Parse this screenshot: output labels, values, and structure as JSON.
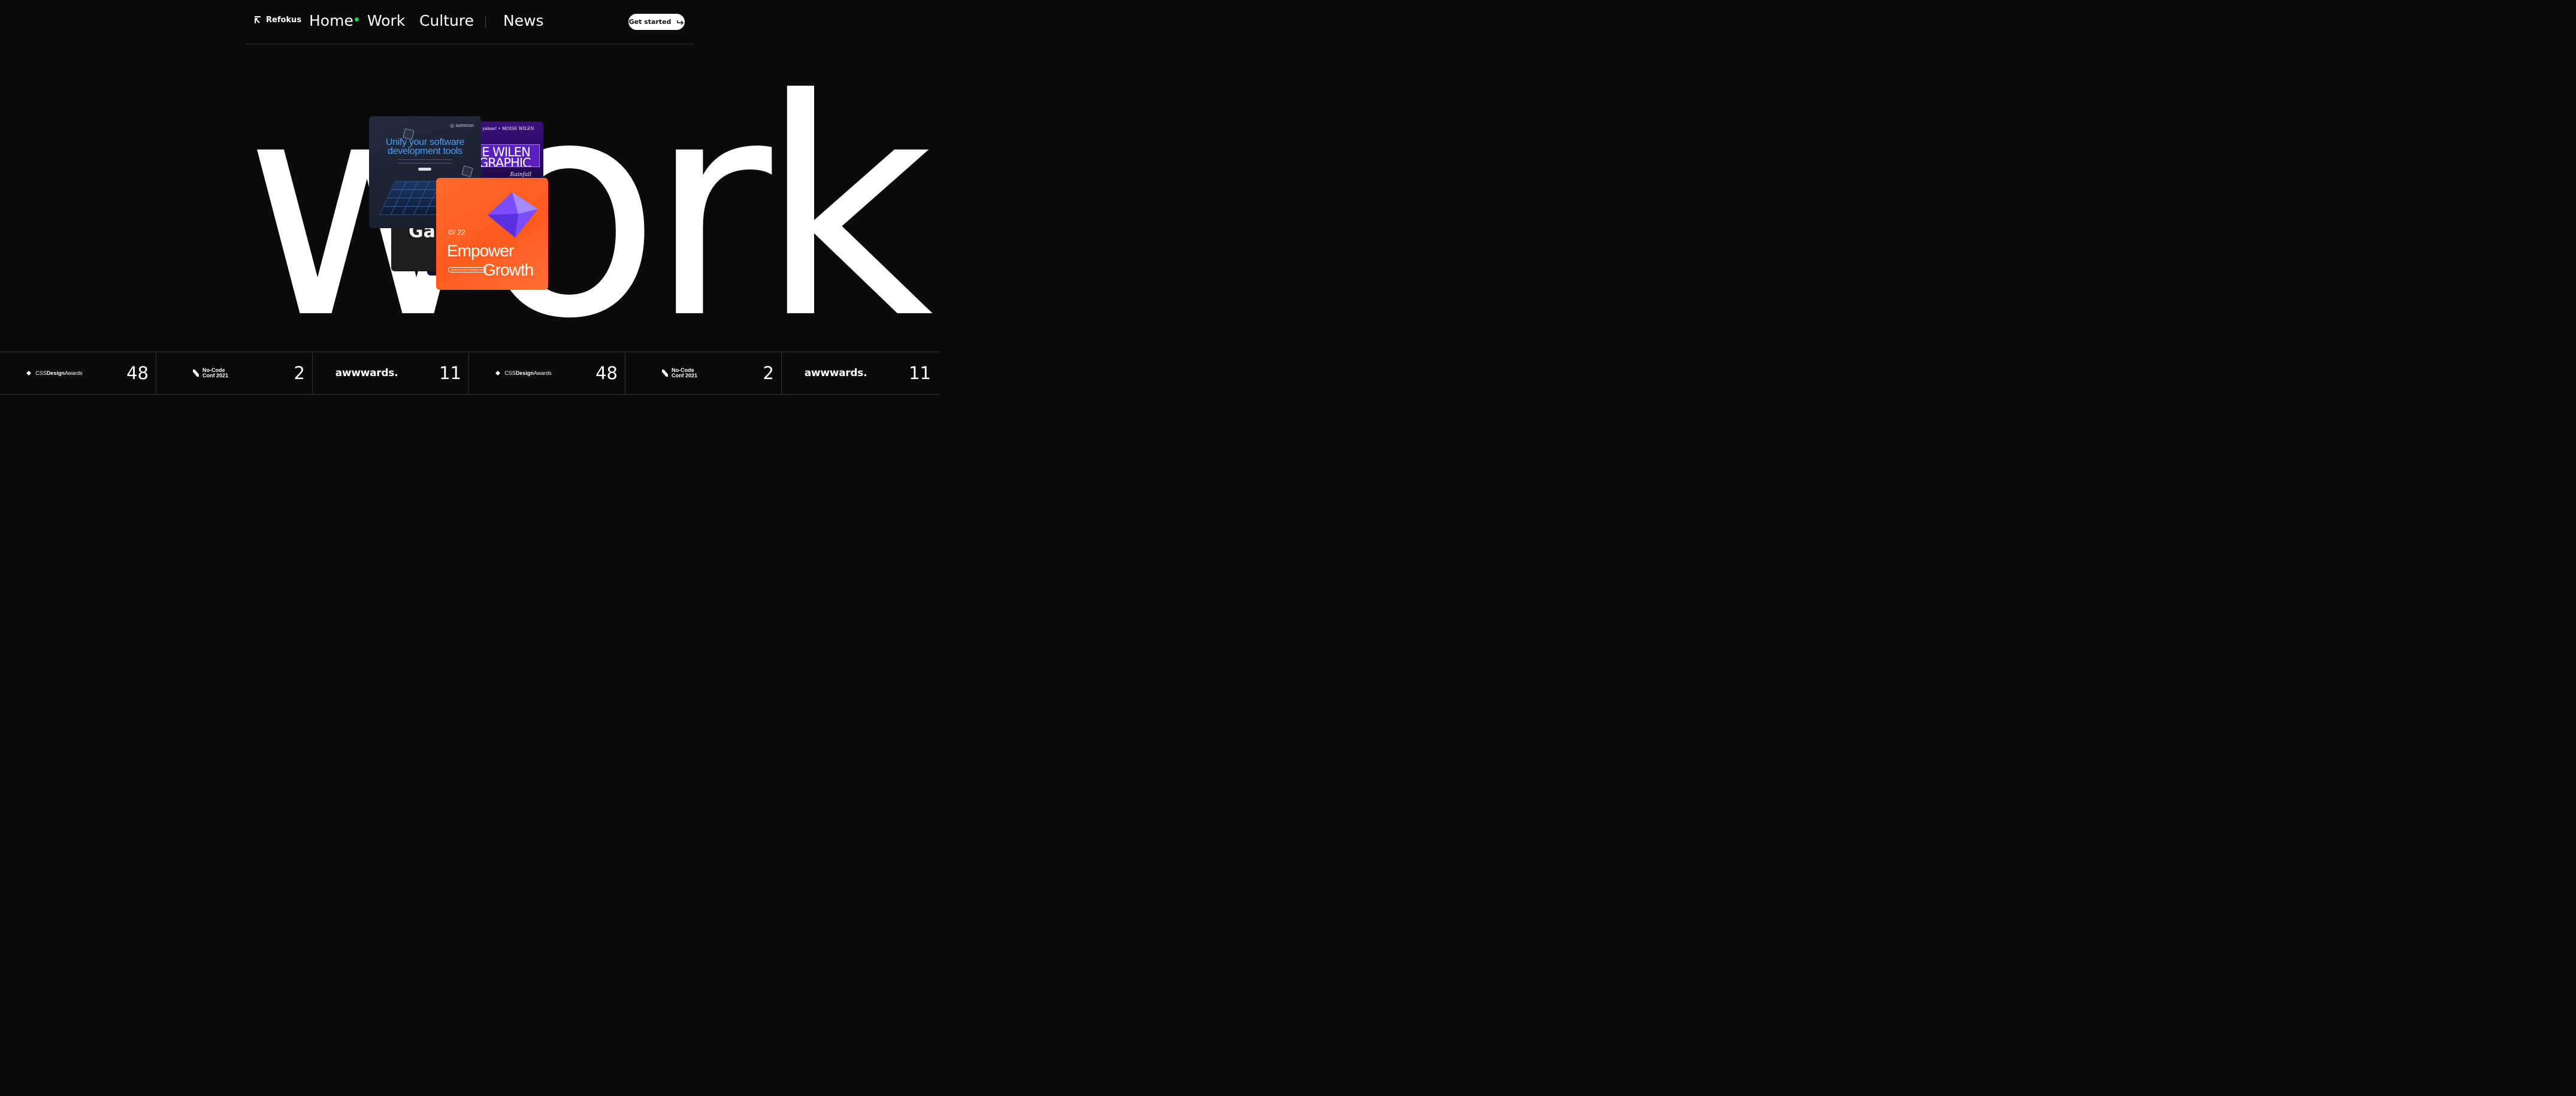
{
  "nav": {
    "brand": "Refokus",
    "links": [
      {
        "label": "Home"
      },
      {
        "label": "Work"
      },
      {
        "label": "Culture"
      },
      {
        "label": "News"
      }
    ],
    "cta_label": "Get started",
    "active_dot_color": "#22c55e"
  },
  "hero": {
    "word": "work",
    "cards": {
      "summon": {
        "brand": "summon",
        "headline_1": "Unify your software",
        "headline_2": "development tools"
      },
      "purple": {
        "top": "yahoo!  •  MOISE WILEN",
        "name": "IE WILEN",
        "name2": "GRAPHIC",
        "sub": "Rainfall"
      },
      "dark": {
        "text": "Ga"
      },
      "orange": {
        "year": "©/ 22",
        "line1": "Empower",
        "line2": "Growth",
        "tag": "SHOWCASE WEBSITES"
      }
    }
  },
  "awards": [
    {
      "org": "CSSDesignAwards",
      "org_a": "CSS",
      "org_b": "Design",
      "org_c": "Awards",
      "count": "48",
      "icon": "cssda-icon"
    },
    {
      "org": "No-Code Conf 2021",
      "line1": "No-Code",
      "line2": "Conf 2021",
      "count": "2",
      "icon": "nocode-icon"
    },
    {
      "org": "awwwards.",
      "count": "11",
      "icon": ""
    },
    {
      "org": "CSSDesignAwards",
      "org_a": "CSS",
      "org_b": "Design",
      "org_c": "Awards",
      "count": "48",
      "icon": "cssda-icon"
    },
    {
      "org": "No-Code Conf 2021",
      "line1": "No-Code",
      "line2": "Conf 2021",
      "count": "2",
      "icon": "nocode-icon"
    },
    {
      "org": "awwwards.",
      "count": "11",
      "icon": ""
    }
  ]
}
